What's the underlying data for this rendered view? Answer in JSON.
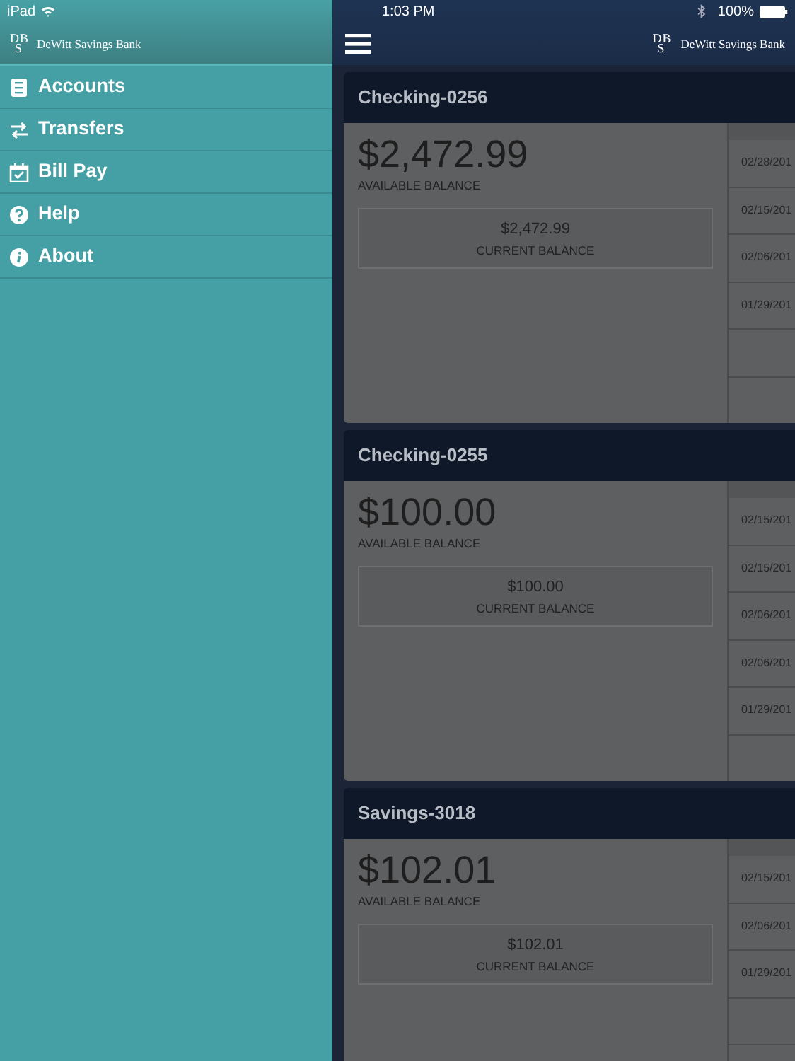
{
  "status_bar": {
    "device": "iPad",
    "time": "1:03 PM",
    "battery": "100%"
  },
  "sidebar": {
    "logo": {
      "monogram": "DBS",
      "name": "DeWitt Savings Bank"
    },
    "items": [
      {
        "label": "Accounts",
        "kind": "accounts"
      },
      {
        "label": "Transfers",
        "kind": "transfers"
      },
      {
        "label": "Bill Pay",
        "kind": "billpay"
      },
      {
        "label": "Help",
        "kind": "help"
      },
      {
        "label": "About",
        "kind": "about"
      }
    ]
  },
  "header": {
    "logo": {
      "monogram": "DBS",
      "name": "DeWitt Savings Bank"
    }
  },
  "accounts": [
    {
      "name": "Checking-0256",
      "available": "$2,472.99",
      "available_label": "AVAILABLE BALANCE",
      "current": "$2,472.99",
      "current_label": "CURRENT BALANCE",
      "rows": [
        {
          "kind": "date",
          "date": "02/28/201"
        },
        {
          "kind": "date",
          "date": "02/15/201"
        },
        {
          "kind": "date",
          "date": "02/06/201"
        },
        {
          "kind": "date",
          "date": "01/29/201"
        },
        {
          "kind": "empty"
        }
      ]
    },
    {
      "name": "Checking-0255",
      "available": "$100.00",
      "available_label": "AVAILABLE BALANCE",
      "current": "$100.00",
      "current_label": "CURRENT BALANCE",
      "rows": [
        {
          "kind": "date",
          "date": "02/15/201"
        },
        {
          "kind": "date",
          "date": "02/15/201"
        },
        {
          "kind": "date",
          "date": "02/06/201"
        },
        {
          "kind": "date",
          "date": "02/06/201"
        },
        {
          "kind": "date",
          "date": "01/29/201"
        }
      ]
    },
    {
      "name": "Savings-3018",
      "available": "$102.01",
      "available_label": "AVAILABLE BALANCE",
      "current": "$102.01",
      "current_label": "CURRENT BALANCE",
      "rows": [
        {
          "kind": "date",
          "date": "02/15/201"
        },
        {
          "kind": "date",
          "date": "02/06/201"
        },
        {
          "kind": "date",
          "date": "01/29/201"
        },
        {
          "kind": "empty"
        }
      ]
    }
  ]
}
